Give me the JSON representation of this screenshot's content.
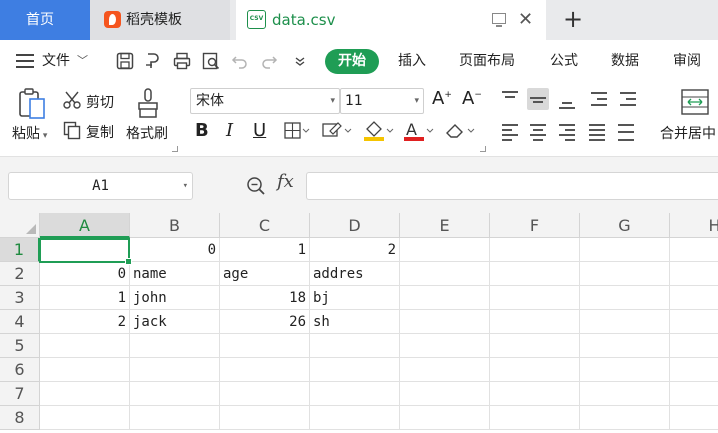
{
  "tabs": {
    "home": "首页",
    "template": "稻壳模板",
    "file": "data.csv",
    "file_icon": "CSV"
  },
  "menu": {
    "file": "文件",
    "ribbon_tabs": [
      "开始",
      "插入",
      "页面布局",
      "公式",
      "数据",
      "审阅"
    ]
  },
  "ribbon": {
    "paste": "粘贴",
    "cut": "剪切",
    "copy": "复制",
    "format_painter": "格式刷",
    "font_name": "宋体",
    "font_size": "11",
    "bold": "B",
    "italic": "I",
    "underline": "U",
    "merge_center": "合并居中"
  },
  "formula_bar": {
    "name_box": "A1",
    "fx": "fx",
    "formula": ""
  },
  "grid": {
    "columns": [
      "A",
      "B",
      "C",
      "D",
      "E",
      "F",
      "G",
      "H"
    ],
    "rows": [
      "1",
      "2",
      "3",
      "4",
      "5",
      "6",
      "7",
      "8"
    ],
    "active_cell": "A1",
    "cells": {
      "B1": "0",
      "C1": "1",
      "D1": "2",
      "A2": "0",
      "B2": "name",
      "C2": "age",
      "D2": "addres",
      "A3": "1",
      "B3": "john",
      "C3": "18",
      "D3": "bj",
      "A4": "2",
      "B4": "jack",
      "C4": "26",
      "D4": "sh"
    }
  },
  "colors": {
    "home_tab": "#3e7ee2",
    "accent_green": "#1f9d55",
    "template_logo": "#f5551f"
  }
}
